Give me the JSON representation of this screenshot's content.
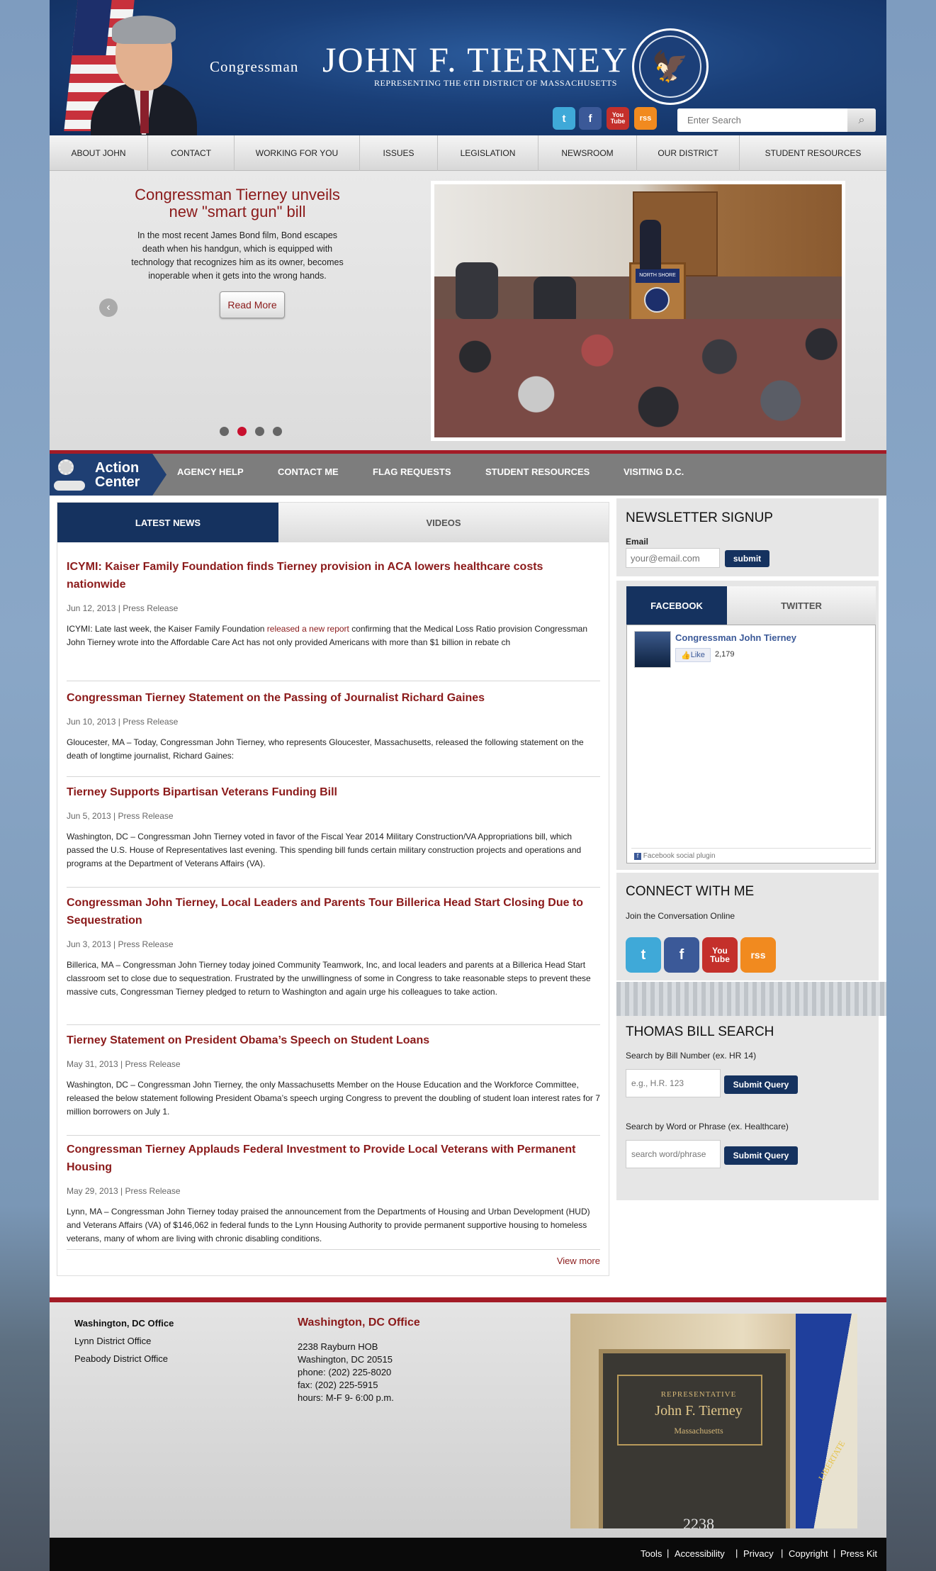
{
  "header": {
    "title_prefix": "Congressman",
    "title_name": "John F. Tierney",
    "subtitle": "Representing the 6th District of Massachusetts",
    "search_placeholder": "Enter Search",
    "social": [
      {
        "icon": "twitter-icon",
        "glyph": "t",
        "color": "#3fa9d8"
      },
      {
        "icon": "facebook-icon",
        "glyph": "f",
        "color": "#3b5998"
      },
      {
        "icon": "youtube-icon",
        "glyph": "You Tube",
        "color": "#c4302b"
      },
      {
        "icon": "rss-icon",
        "glyph": "rss",
        "color": "#f18a1f"
      }
    ]
  },
  "nav": [
    "ABOUT JOHN",
    "CONTACT",
    "WORKING FOR YOU",
    "ISSUES",
    "LEGISLATION",
    "NEWSROOM",
    "OUR DISTRICT",
    "STUDENT RESOURCES"
  ],
  "slider": {
    "title": "Congressman Tierney unveils new \"smart gun\" bill",
    "text": "In the most recent James Bond film, Bond escapes death when his handgun, which is equipped with technology that recognizes him as its owner, becomes inoperable when it gets into the wrong hands.",
    "button": "Read More",
    "dots": 4,
    "active_dot": 2,
    "podium_sign": "NORTH SHORE"
  },
  "action_center": {
    "title_line1": "Action",
    "title_line2": "Center",
    "links": [
      "AGENCY HELP",
      "CONTACT ME",
      "FLAG REQUESTS",
      "STUDENT RESOURCES",
      "VISITING D.C."
    ]
  },
  "main": {
    "tab_news": "LATEST NEWS",
    "tab_videos": "VIDEOS",
    "news": [
      {
        "title": "ICYMI: Kaiser Family Foundation finds Tierney provision in ACA lowers healthcare costs nationwide",
        "date": "Jun 12, 2013",
        "type": "Press Release",
        "pre": "ICYMI: Late last week, the Kaiser Family Foundation ",
        "link": "released a new report",
        "post": " confirming that the Medical Loss Ratio provision Congressman John Tierney wrote into the Affordable Care Act has not only provided Americans with more than $1 billion in rebate ch"
      },
      {
        "title": "Congressman Tierney Statement on the Passing of Journalist Richard Gaines",
        "date": "Jun 10, 2013",
        "type": "Press Release",
        "pre": "Gloucester, MA – Today, Congressman John Tierney, who represents Gloucester, Massachusetts, released the following statement on the death of longtime journalist, Richard Gaines:",
        "link": "",
        "post": ""
      },
      {
        "title": "Tierney Supports Bipartisan Veterans Funding Bill",
        "date": "Jun 5, 2013",
        "type": "Press Release",
        "pre": "Washington, DC – Congressman John Tierney voted in favor of the Fiscal Year 2014 Military Construction/VA Appropriations bill, which passed the U.S. House of Representatives last evening. This spending bill funds certain military construction projects and operations and programs at the Department of Veterans Affairs (VA).",
        "link": "",
        "post": ""
      },
      {
        "title": "Congressman John Tierney, Local Leaders and Parents Tour Billerica Head Start Closing Due to Sequestration",
        "date": "Jun 3, 2013",
        "type": "Press Release",
        "pre": "Billerica, MA – Congressman John Tierney today joined Community Teamwork, Inc, and local leaders and parents at a Billerica Head Start classroom set to close due to sequestration. Frustrated by the unwillingness of some in Congress to take reasonable steps to prevent these massive cuts, Congressman Tierney pledged to return to Washington and again urge his colleagues to take action.",
        "link": "",
        "post": ""
      },
      {
        "title": "Tierney Statement on President Obama’s Speech on Student Loans",
        "date": "May 31, 2013",
        "type": "Press Release",
        "pre": "Washington, DC – Congressman John Tierney, the only Massachusetts Member on the House Education and the Workforce Committee, released the below statement following President Obama’s speech urging Congress to prevent the doubling of student loan interest rates for 7 million borrowers on July 1.",
        "link": "",
        "post": ""
      },
      {
        "title": "Congressman Tierney Applauds Federal Investment to Provide Local Veterans with Permanent Housing",
        "date": "May 29, 2013",
        "type": "Press Release",
        "pre": "Lynn, MA – Congressman John Tierney today praised the announcement from the Departments of Housing and Urban Development (HUD) and Veterans Affairs (VA) of $146,062 in federal funds to the Lynn Housing Authority to provide permanent supportive housing to homeless veterans, many of whom are living with chronic disabling conditions.",
        "link": "",
        "post": ""
      }
    ],
    "view_more": "View more"
  },
  "sidebar": {
    "newsletter_title": "NEWSLETTER SIGNUP",
    "email_label": "Email",
    "email_placeholder": "your@email.com",
    "submit": "submit",
    "fb_tab": "FACEBOOK",
    "tw_tab": "TWITTER",
    "fb_name": "Congressman John Tierney",
    "fb_like": "Like",
    "fb_count": "2,179",
    "fb_plugin": "Facebook social plugin",
    "connect_title": "CONNECT WITH ME",
    "connect_sub": "Join the Conversation Online",
    "thomas_title": "THOMAS BILL SEARCH",
    "bill_label": "Search by Bill Number (ex. HR 14)",
    "bill_placeholder": "e.g., H.R. 123",
    "word_label": "Search by Word or Phrase (ex. Healthcare)",
    "word_placeholder": "search word/phrase",
    "submit_query": "Submit Query"
  },
  "footer": {
    "offices": [
      "Washington, DC Office",
      "Lynn District Office",
      "Peabody District Office"
    ],
    "office_title": "Washington, DC Office",
    "address": [
      "2238 Rayburn HOB",
      "Washington, DC 20515",
      "phone: (202) 225-8020",
      "fax: (202) 225-5915",
      "hours: M-F 9- 6:00 p.m."
    ],
    "plaque": {
      "line1": "REPRESENTATIVE",
      "line2": "John F. Tierney",
      "line3": "Massachusetts",
      "room": "2238"
    },
    "flag_text": "LIBERTATE",
    "bottom_links": [
      "Tools",
      "Accessibility",
      "Privacy",
      "Copyright",
      "Press Kit"
    ]
  },
  "colors": {
    "accent_red": "#8b1a1a",
    "navy": "#15325f",
    "bar_red": "#a31b26"
  }
}
